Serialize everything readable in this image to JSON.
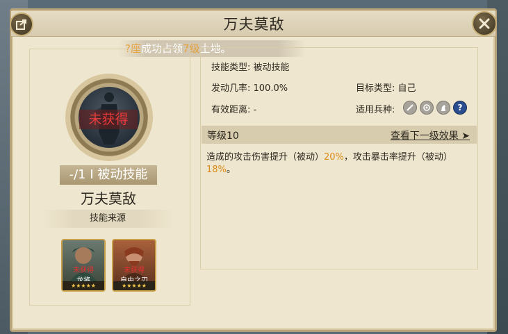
{
  "header": {
    "title": "万夫莫敌"
  },
  "banner": {
    "count1": "?座",
    "text1": "成功占领",
    "count2": "7级",
    "text2": "土地。"
  },
  "left": {
    "status": "未获得",
    "skill_tag": "-/1 I 被动技能",
    "skill_name": "万夫莫敌",
    "source_label": "技能来源",
    "heroes": [
      {
        "status": "未获得",
        "name": "龙将",
        "stars": "★★★★★"
      },
      {
        "status": "未获得",
        "name": "自由之刃",
        "stars": "★★★★★"
      }
    ]
  },
  "details": {
    "skill_type": "技能类型: 被动技能",
    "trigger_rate": "发动几率: 100.0%",
    "target_type": "目标类型: 自己",
    "range": "有效距离: -",
    "unit_types_label": "适用兵种:",
    "unit_icons": [
      "sword-icon",
      "target-icon",
      "horse-icon",
      "help-icon"
    ]
  },
  "level": {
    "label": "等级10",
    "next_label": "查看下一级效果 ➤"
  },
  "description": {
    "p1": "造成的攻击伤害提升（被动）",
    "v1": "20%",
    "p2": "，攻击暴击率提升（被动）",
    "v2": "18%",
    "p3": "。"
  }
}
